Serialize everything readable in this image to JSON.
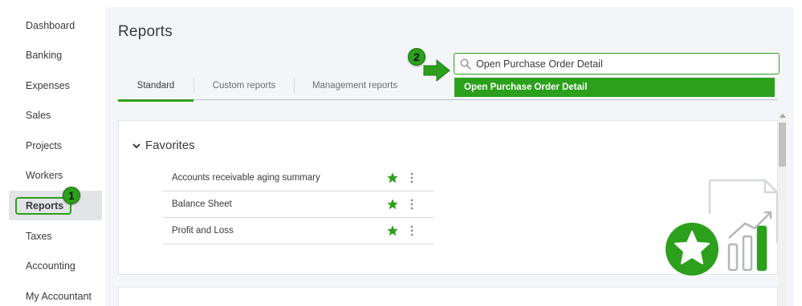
{
  "sidebar": {
    "items": [
      {
        "label": "Dashboard"
      },
      {
        "label": "Banking"
      },
      {
        "label": "Expenses"
      },
      {
        "label": "Sales"
      },
      {
        "label": "Projects"
      },
      {
        "label": "Workers"
      },
      {
        "label": "Reports",
        "active": true
      },
      {
        "label": "Taxes"
      },
      {
        "label": "Accounting"
      },
      {
        "label": "My Accountant"
      }
    ]
  },
  "page": {
    "title": "Reports"
  },
  "tabs": [
    {
      "label": "Standard",
      "active": true
    },
    {
      "label": "Custom reports"
    },
    {
      "label": "Management reports"
    }
  ],
  "search": {
    "value": "Open Purchase Order Detail",
    "suggestion": "Open Purchase Order Detail"
  },
  "steps": {
    "one": "1",
    "two": "2"
  },
  "favorites": {
    "title": "Favorites",
    "items": [
      {
        "label": "Accounts receivable aging summary",
        "starred": true
      },
      {
        "label": "Balance Sheet",
        "starred": true
      },
      {
        "label": "Profit and Loss",
        "starred": true
      }
    ]
  },
  "colors": {
    "accent": "#2ca01c",
    "text": "#393a3d",
    "muted": "#6b6c72",
    "background": "#f4f5f8"
  },
  "icons": {
    "search": "search-icon",
    "chevron": "chevron-down-icon",
    "star": "star-icon",
    "kebab": "kebab-menu-icon",
    "arrow": "arrow-right-icon"
  }
}
